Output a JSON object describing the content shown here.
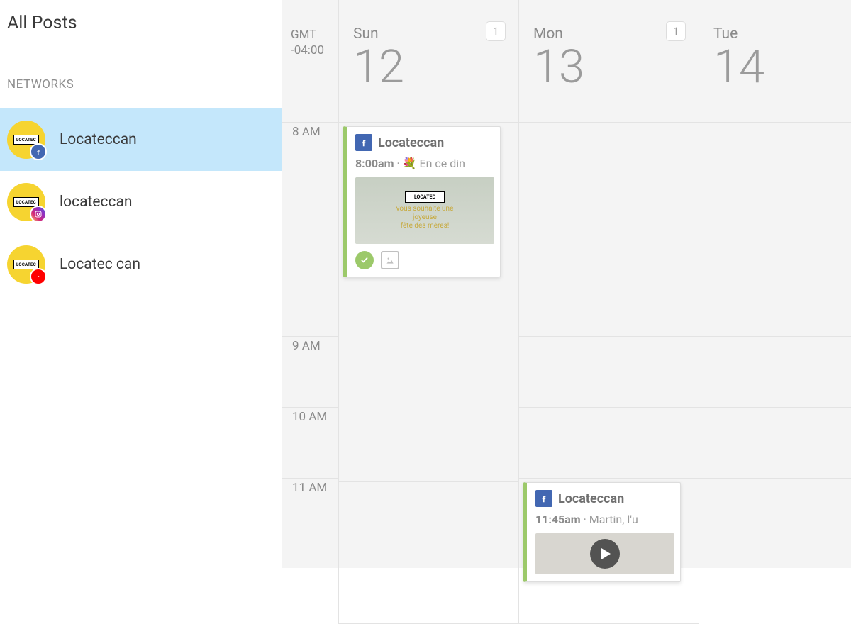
{
  "sidebar": {
    "title": "All Posts",
    "section_label": "NETWORKS",
    "networks": [
      {
        "name": "Locateccan",
        "logo": "LOCATEC",
        "platform": "facebook",
        "selected": true
      },
      {
        "name": "locateccan",
        "logo": "LOCATEC",
        "platform": "instagram",
        "selected": false
      },
      {
        "name": "Locatec can",
        "logo": "LOCATEC",
        "platform": "youtube",
        "selected": false
      }
    ]
  },
  "calendar": {
    "timezone_line1": "GMT",
    "timezone_line2": "-04:00",
    "days": [
      {
        "name": "Sun",
        "num": "12",
        "badge": "1"
      },
      {
        "name": "Mon",
        "num": "13",
        "badge": "1"
      },
      {
        "name": "Tue",
        "num": "14",
        "badge": ""
      }
    ],
    "hours": [
      "8 AM",
      "9 AM",
      "10 AM",
      "11 AM"
    ],
    "posts": {
      "sun_8am": {
        "account": "Locateccan",
        "time": "8:00am",
        "emoji": "💐",
        "preview": "En ce din",
        "img_strip": "LOCATEC",
        "img_line1": "vous souhaite une",
        "img_line2": "joyeuse",
        "img_line3": "fête des mères!"
      },
      "mon_1145": {
        "account": "Locateccan",
        "time": "11:45am",
        "preview": "Martin, l'u"
      }
    }
  }
}
